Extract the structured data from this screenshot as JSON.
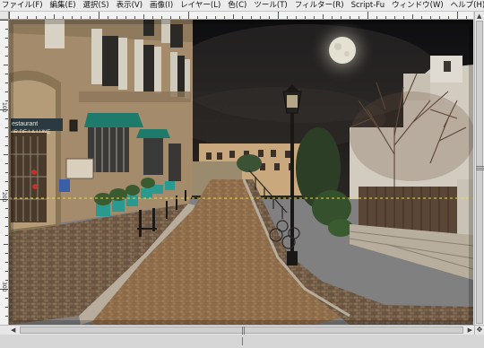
{
  "menubar": {
    "items": [
      {
        "id": "file",
        "label": "ファイル(F)"
      },
      {
        "id": "edit",
        "label": "編集(E)"
      },
      {
        "id": "select",
        "label": "選択(S)"
      },
      {
        "id": "view",
        "label": "表示(V)"
      },
      {
        "id": "image",
        "label": "画像(I)"
      },
      {
        "id": "layer",
        "label": "レイヤー(L)"
      },
      {
        "id": "color",
        "label": "色(C)"
      },
      {
        "id": "tools",
        "label": "ツール(T)"
      },
      {
        "id": "filters",
        "label": "フィルター(R)"
      },
      {
        "id": "scriptfu",
        "label": "Script-Fu"
      },
      {
        "id": "windows",
        "label": "ウィンドウ(W)"
      },
      {
        "id": "help",
        "label": "ヘルプ(H)"
      }
    ]
  },
  "ruler": {
    "top_labels": [
      "0",
      "",
      "",
      "",
      "",
      ""
    ],
    "left_labels": [
      "100",
      "200",
      "300"
    ]
  },
  "canvas": {
    "shop_sign_line1": "estaurant",
    "shop_sign_line2": "IR DE LA LUNE",
    "selection": "dashed-marching-ants"
  },
  "scrollbar": {
    "corner_icon": "navigate-icon",
    "corner_glyph": "✥"
  },
  "colors": {
    "sky": "#141416",
    "moon": "#e8e6dc",
    "building": "#a08a6c",
    "awning": "#1e7a6a",
    "cobble": "#8a6a48",
    "selection": "#e8d65a"
  }
}
